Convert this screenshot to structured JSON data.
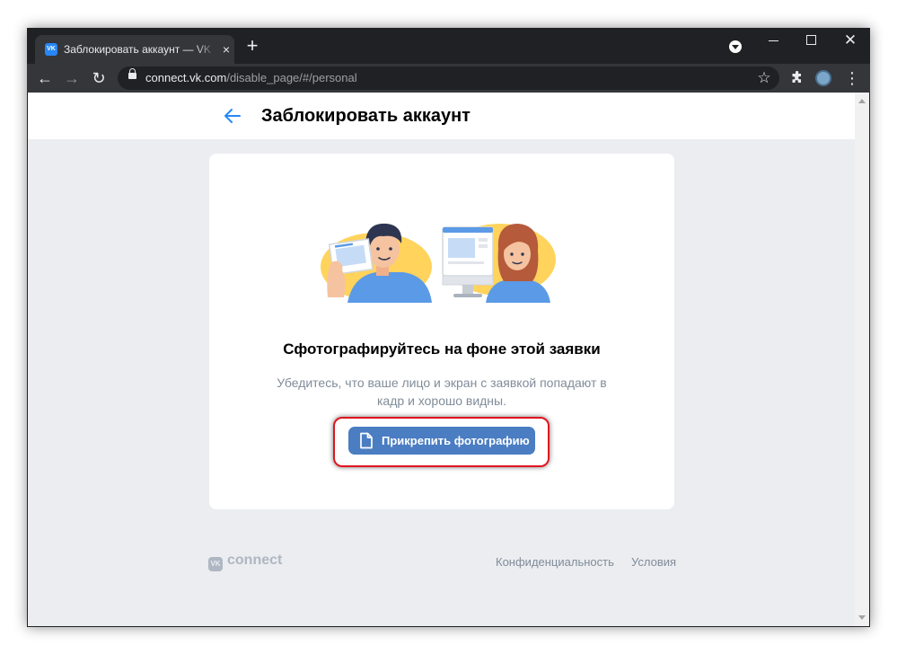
{
  "browser": {
    "tab_title": "Заблокировать аккаунт — VK Connect",
    "tab_favicon_text": "VK",
    "close_tab_glyph": "×",
    "new_tab_glyph": "+",
    "close_window_glyph": "✕",
    "url_host": "connect.vk.com",
    "url_path": "/disable_page/#/personal",
    "back_glyph": "←",
    "forward_glyph": "→",
    "reload_glyph": "↻",
    "bookmark_glyph": "☆",
    "menu_glyph": "⋮"
  },
  "page": {
    "title": "Заблокировать аккаунт"
  },
  "card": {
    "heading": "Сфотографируйтесь на фоне этой заявки",
    "description": "Убедитесь, что ваше лицо и экран с заявкой попадают в кадр и хорошо видны.",
    "attach_button_label": "Прикрепить фотографию"
  },
  "footer": {
    "logo_badge": "VK",
    "logo_text": "connect",
    "privacy_link": "Конфиденциальность",
    "terms_link": "Условия"
  },
  "colors": {
    "accent": "#4a7dc2",
    "highlight": "#e0141e",
    "page_background": "#ebedf0"
  },
  "icons": {
    "back": "arrow-left-icon",
    "attach": "document-icon",
    "lock": "lock-icon",
    "bookmark": "star-icon",
    "extensions": "puzzle-icon"
  }
}
